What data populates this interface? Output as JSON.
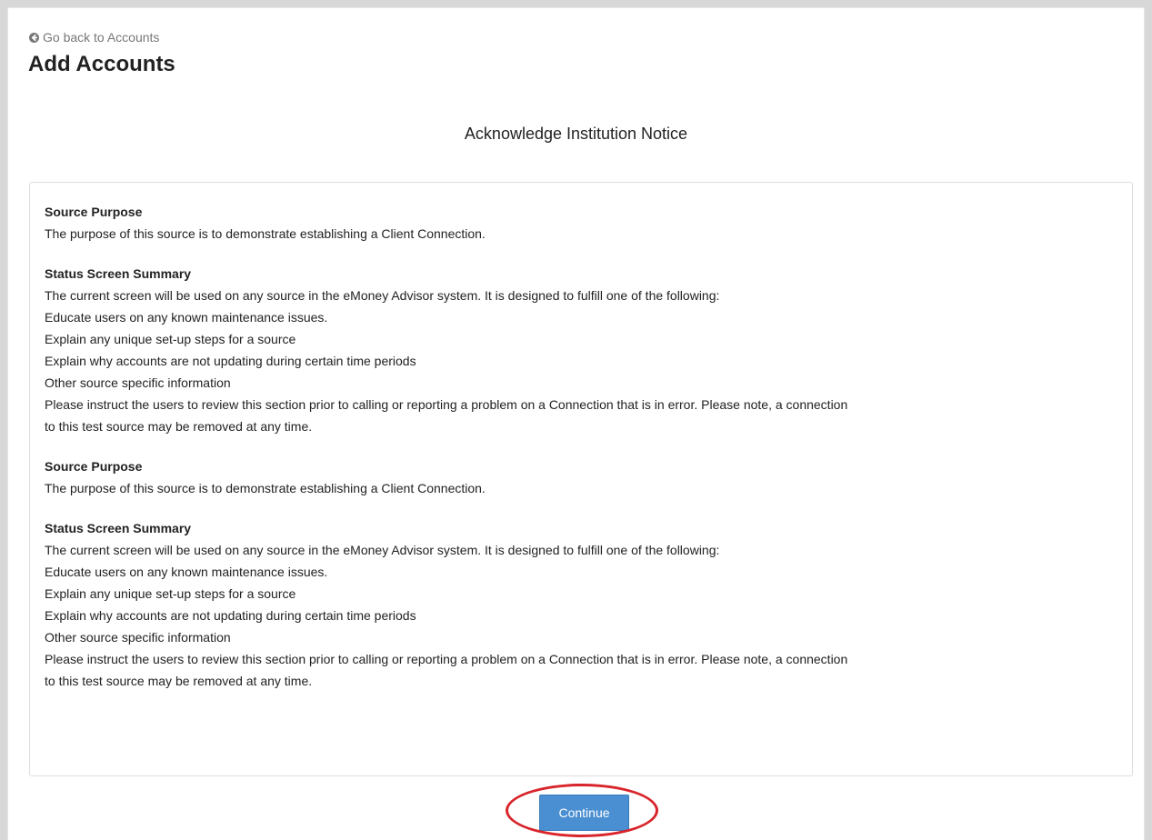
{
  "nav": {
    "back_label": "Go back to Accounts",
    "back_icon": "circle-arrow-left-icon"
  },
  "header": {
    "title": "Add Accounts"
  },
  "notice": {
    "heading": "Acknowledge Institution Notice",
    "sections": [
      {
        "title": "Source Purpose",
        "lines": [
          "The purpose of this source is to demonstrate establishing a Client Connection."
        ]
      },
      {
        "title": "Status Screen Summary",
        "lines": [
          "The current screen will be used on any source in the eMoney Advisor system. It is designed to fulfill one of the following:",
          "Educate users on any known maintenance issues.",
          "Explain any unique set-up steps for a source",
          "Explain why accounts are not updating during certain time periods",
          "Other source specific information",
          "Please instruct the users to review this section prior to calling or reporting a problem on a Connection that is in error. Please note, a connection",
          "to this test source may be removed at any time."
        ]
      },
      {
        "title": "Source Purpose",
        "lines": [
          "The purpose of this source is to demonstrate establishing a Client Connection."
        ]
      },
      {
        "title": "Status Screen Summary",
        "lines": [
          "The current screen will be used on any source in the eMoney Advisor system. It is designed to fulfill one of the following:",
          "Educate users on any known maintenance issues.",
          "Explain any unique set-up steps for a source",
          "Explain why accounts are not updating during certain time periods",
          "Other source specific information",
          "Please instruct the users to review this section prior to calling or reporting a problem on a Connection that is in error. Please note, a connection",
          "to this test source may be removed at any time."
        ]
      }
    ]
  },
  "actions": {
    "continue_label": "Continue"
  },
  "colors": {
    "button_bg": "#4a8fd1",
    "highlight_ring": "#d8242a",
    "back_link": "#777777"
  }
}
